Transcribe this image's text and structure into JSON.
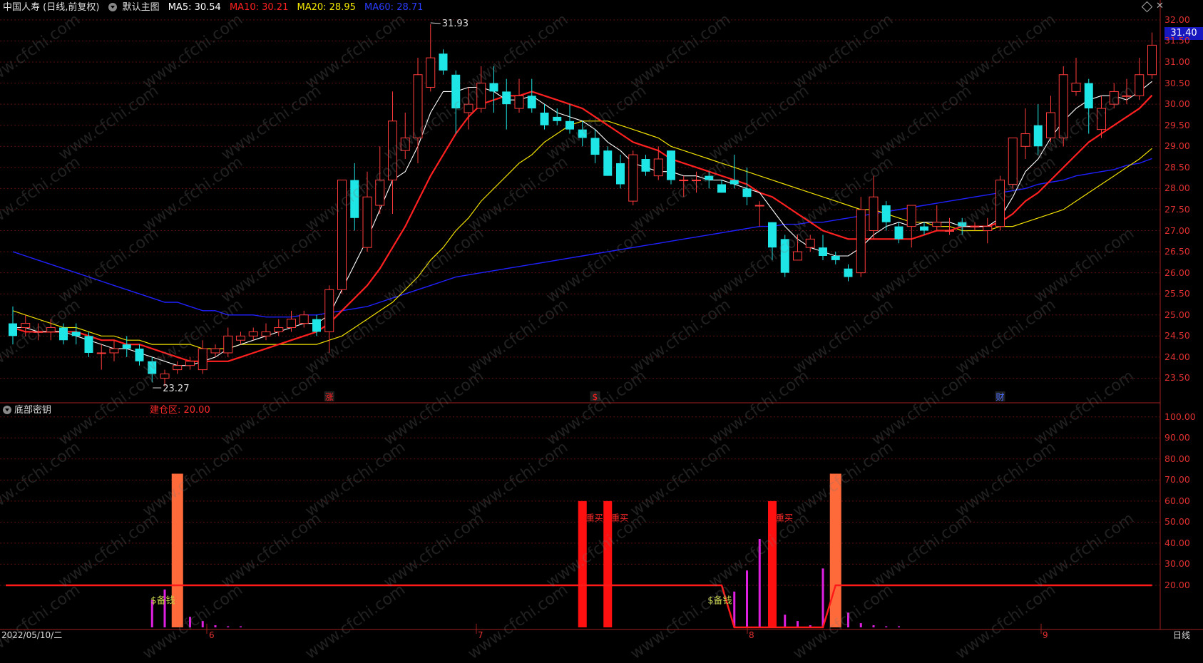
{
  "header": {
    "title": "中国人寿 (日线,前复权)",
    "chart_name": "默认主图",
    "ma5": "MA5: 30.54",
    "ma10": "MA10: 30.21",
    "ma20": "MA20: 28.95",
    "ma60": "MA60: 28.71"
  },
  "sub_header": {
    "name": "底部密钥",
    "value": "建仓区: 20.00"
  },
  "current_price_tag": "31.40",
  "markers": {
    "high": "31.93",
    "low": "23.27",
    "event_up": "涨",
    "event_dollar": "$",
    "event_fin": "财"
  },
  "sub_text": {
    "bei_qian": "$备钱",
    "zhong_mai": "重买"
  },
  "bottom": {
    "date": "2022/05/10/二",
    "months": [
      "6",
      "7",
      "8",
      "9"
    ],
    "period": "日线"
  },
  "watermark": "www.cfchi.com",
  "colors": {
    "bull": "#ff3b3b",
    "bear": "#1fe6e6",
    "ma5": "#ffffff",
    "ma10": "#ff2020",
    "ma20": "#f0e000",
    "ma60": "#2020ff",
    "axis_text": "#e03030"
  },
  "chart_data": [
    {
      "type": "candlestick",
      "title": "中国人寿 (日线,前复权)",
      "ylim": [
        23.0,
        32.1
      ],
      "y_ticks": [
        "32.00",
        "31.50",
        "31.00",
        "30.50",
        "30.00",
        "29.50",
        "29.00",
        "28.50",
        "28.00",
        "27.50",
        "27.00",
        "26.50",
        "26.00",
        "25.50",
        "25.00",
        "24.50",
        "24.00",
        "23.50"
      ],
      "candles": [
        [
          24.8,
          24.5,
          25.2,
          24.3
        ],
        [
          24.7,
          24.8,
          25.0,
          24.5
        ],
        [
          24.6,
          24.6,
          24.8,
          24.4
        ],
        [
          24.6,
          24.7,
          24.9,
          24.4
        ],
        [
          24.7,
          24.4,
          24.8,
          24.3
        ],
        [
          24.6,
          24.5,
          24.8,
          24.3
        ],
        [
          24.5,
          24.1,
          24.6,
          24.0
        ],
        [
          24.1,
          24.1,
          24.3,
          23.7
        ],
        [
          24.1,
          24.2,
          24.4,
          23.9
        ],
        [
          24.3,
          24.2,
          24.5,
          24.0
        ],
        [
          24.2,
          23.9,
          24.3,
          23.8
        ],
        [
          23.9,
          23.6,
          24.0,
          23.4
        ],
        [
          23.5,
          23.6,
          23.7,
          23.3
        ],
        [
          23.7,
          23.8,
          23.9,
          23.6
        ],
        [
          23.8,
          23.9,
          24.0,
          23.7
        ],
        [
          23.7,
          24.2,
          24.4,
          23.6
        ],
        [
          24.1,
          24.2,
          24.3,
          24.0
        ],
        [
          24.1,
          24.5,
          24.7,
          24.0
        ],
        [
          24.4,
          24.5,
          24.6,
          24.3
        ],
        [
          24.5,
          24.6,
          24.7,
          24.4
        ],
        [
          24.5,
          24.6,
          24.8,
          24.4
        ],
        [
          24.6,
          24.7,
          24.9,
          24.5
        ],
        [
          24.7,
          24.9,
          25.1,
          24.6
        ],
        [
          24.8,
          25.0,
          25.1,
          24.7
        ],
        [
          24.9,
          24.6,
          25.0,
          24.5
        ],
        [
          24.6,
          25.6,
          25.7,
          24.1
        ],
        [
          25.6,
          28.2,
          28.2,
          25.5
        ],
        [
          28.2,
          27.3,
          28.6,
          27.0
        ],
        [
          26.6,
          27.8,
          28.4,
          26.5
        ],
        [
          27.6,
          28.2,
          29.0,
          27.4
        ],
        [
          28.2,
          29.6,
          30.3,
          27.4
        ],
        [
          28.9,
          29.2,
          29.8,
          28.7
        ],
        [
          29.2,
          30.7,
          31.1,
          28.6
        ],
        [
          30.4,
          31.1,
          31.9,
          30.3
        ],
        [
          31.2,
          30.8,
          31.3,
          30.7
        ],
        [
          30.7,
          29.9,
          30.8,
          29.3
        ],
        [
          29.8,
          30.0,
          30.4,
          29.4
        ],
        [
          29.9,
          30.5,
          30.9,
          29.8
        ],
        [
          30.5,
          30.3,
          30.9,
          29.8
        ],
        [
          30.3,
          30.0,
          30.6,
          29.4
        ],
        [
          29.9,
          30.2,
          30.6,
          29.8
        ],
        [
          30.2,
          29.9,
          30.6,
          29.8
        ],
        [
          29.8,
          29.5,
          30.0,
          29.4
        ],
        [
          29.7,
          29.6,
          29.9,
          29.5
        ],
        [
          29.6,
          29.4,
          30.0,
          29.3
        ],
        [
          29.4,
          29.2,
          29.6,
          29.0
        ],
        [
          29.2,
          28.8,
          29.4,
          28.6
        ],
        [
          28.9,
          28.3,
          29.0,
          28.3
        ],
        [
          28.6,
          28.1,
          28.8,
          28.0
        ],
        [
          27.7,
          28.8,
          28.9,
          27.6
        ],
        [
          28.7,
          28.4,
          28.8,
          28.3
        ],
        [
          28.3,
          28.7,
          29.0,
          28.2
        ],
        [
          28.9,
          28.2,
          28.9,
          28.1
        ],
        [
          28.2,
          28.2,
          28.3,
          27.8
        ],
        [
          28.2,
          28.2,
          28.4,
          27.9
        ],
        [
          28.3,
          28.2,
          28.4,
          28.0
        ],
        [
          28.1,
          27.9,
          28.2,
          27.9
        ],
        [
          28.2,
          28.1,
          28.8,
          28.0
        ],
        [
          28.0,
          27.8,
          28.5,
          27.6
        ],
        [
          27.6,
          27.6,
          27.7,
          27.1
        ],
        [
          27.2,
          26.6,
          27.2,
          26.3
        ],
        [
          26.8,
          26.0,
          26.9,
          25.9
        ],
        [
          26.3,
          26.5,
          26.9,
          26.3
        ],
        [
          26.6,
          26.8,
          26.9,
          26.5
        ],
        [
          26.6,
          26.4,
          26.9,
          26.3
        ],
        [
          26.4,
          26.3,
          26.5,
          26.2
        ],
        [
          26.1,
          25.9,
          26.2,
          25.8
        ],
        [
          26.0,
          27.5,
          27.8,
          25.9
        ],
        [
          27.0,
          27.8,
          28.3,
          26.8
        ],
        [
          27.6,
          27.2,
          27.7,
          27.0
        ],
        [
          27.1,
          26.8,
          27.2,
          26.7
        ],
        [
          27.1,
          27.6,
          27.6,
          26.6
        ],
        [
          27.1,
          27.0,
          27.2,
          26.9
        ],
        [
          27.1,
          27.2,
          27.6,
          27.0
        ],
        [
          27.0,
          27.0,
          27.3,
          26.9
        ],
        [
          27.2,
          27.1,
          27.3,
          26.9
        ],
        [
          27.1,
          27.1,
          27.2,
          27.0
        ],
        [
          27.0,
          27.1,
          27.3,
          26.7
        ],
        [
          27.1,
          28.2,
          28.3,
          27.0
        ],
        [
          28.1,
          29.2,
          29.2,
          28.0
        ],
        [
          29.0,
          29.3,
          29.9,
          28.7
        ],
        [
          29.5,
          29.0,
          30.0,
          28.8
        ],
        [
          29.2,
          29.8,
          30.2,
          29.1
        ],
        [
          29.2,
          30.7,
          30.9,
          29.0
        ],
        [
          30.3,
          30.5,
          31.1,
          30.2
        ],
        [
          30.5,
          29.9,
          30.6,
          29.3
        ],
        [
          29.4,
          29.9,
          30.2,
          29.2
        ],
        [
          30.0,
          30.3,
          30.5,
          29.9
        ],
        [
          30.2,
          30.2,
          30.6,
          30.0
        ],
        [
          30.2,
          30.7,
          31.1,
          30.1
        ],
        [
          30.7,
          31.4,
          31.7,
          30.6
        ]
      ],
      "ma5": [
        24.7,
        24.7,
        24.6,
        24.6,
        24.6,
        24.5,
        24.4,
        24.3,
        24.2,
        24.2,
        24.1,
        24.0,
        23.9,
        23.8,
        23.8,
        23.9,
        24.0,
        24.2,
        24.3,
        24.4,
        24.5,
        24.6,
        24.7,
        24.8,
        24.8,
        25.0,
        25.6,
        26.2,
        26.8,
        27.5,
        28.2,
        28.4,
        29.0,
        29.8,
        30.3,
        30.3,
        30.4,
        30.4,
        30.3,
        30.1,
        30.1,
        30.2,
        30.0,
        29.8,
        29.7,
        29.6,
        29.4,
        29.1,
        28.9,
        28.6,
        28.5,
        28.4,
        28.4,
        28.3,
        28.3,
        28.2,
        28.2,
        28.1,
        28.0,
        27.9,
        27.5,
        27.1,
        26.8,
        26.6,
        26.5,
        26.4,
        26.4,
        26.6,
        26.9,
        27.1,
        27.2,
        27.1,
        27.2,
        27.2,
        27.2,
        27.1,
        27.1,
        27.1,
        27.3,
        27.8,
        28.4,
        28.7,
        29.2,
        29.6,
        29.9,
        30.1,
        30.2,
        30.2,
        30.1,
        30.3,
        30.54
      ],
      "ma10": [
        24.7,
        24.6,
        24.6,
        24.6,
        24.6,
        24.6,
        24.5,
        24.4,
        24.4,
        24.3,
        24.3,
        24.2,
        24.1,
        24.0,
        23.9,
        23.9,
        23.9,
        23.9,
        24.0,
        24.1,
        24.2,
        24.3,
        24.4,
        24.5,
        24.6,
        24.8,
        25.1,
        25.4,
        25.7,
        26.1,
        26.6,
        27.1,
        27.7,
        28.3,
        28.8,
        29.3,
        29.7,
        30.0,
        30.1,
        30.2,
        30.2,
        30.3,
        30.2,
        30.1,
        30.0,
        29.9,
        29.7,
        29.5,
        29.3,
        29.1,
        29.0,
        28.9,
        28.7,
        28.6,
        28.5,
        28.4,
        28.3,
        28.2,
        28.1,
        27.9,
        27.8,
        27.6,
        27.4,
        27.2,
        27.0,
        26.9,
        26.8,
        26.8,
        26.8,
        26.8,
        26.8,
        26.8,
        26.9,
        27.0,
        27.0,
        27.1,
        27.1,
        27.1,
        27.2,
        27.4,
        27.7,
        27.9,
        28.2,
        28.5,
        28.8,
        29.1,
        29.3,
        29.5,
        29.7,
        29.9,
        30.21
      ],
      "ma20": [
        25.1,
        25.0,
        24.9,
        24.8,
        24.7,
        24.7,
        24.6,
        24.5,
        24.5,
        24.4,
        24.4,
        24.3,
        24.3,
        24.3,
        24.3,
        24.2,
        24.2,
        24.2,
        24.3,
        24.3,
        24.3,
        24.3,
        24.3,
        24.3,
        24.3,
        24.4,
        24.5,
        24.7,
        24.9,
        25.1,
        25.3,
        25.6,
        25.9,
        26.3,
        26.6,
        27.0,
        27.3,
        27.7,
        28.0,
        28.3,
        28.6,
        28.8,
        29.1,
        29.3,
        29.5,
        29.6,
        29.6,
        29.6,
        29.5,
        29.4,
        29.3,
        29.2,
        29.0,
        28.9,
        28.8,
        28.7,
        28.6,
        28.5,
        28.4,
        28.3,
        28.2,
        28.1,
        28.0,
        27.9,
        27.8,
        27.7,
        27.6,
        27.5,
        27.5,
        27.4,
        27.3,
        27.2,
        27.2,
        27.1,
        27.1,
        27.0,
        27.0,
        27.0,
        27.1,
        27.1,
        27.2,
        27.3,
        27.4,
        27.5,
        27.7,
        27.9,
        28.1,
        28.3,
        28.5,
        28.7,
        28.95
      ],
      "ma60": [
        26.5,
        26.4,
        26.3,
        26.2,
        26.1,
        26.0,
        25.9,
        25.8,
        25.7,
        25.6,
        25.5,
        25.4,
        25.3,
        25.3,
        25.2,
        25.1,
        25.1,
        25.0,
        25.0,
        25.0,
        24.95,
        24.95,
        24.95,
        25.0,
        25.0,
        25.05,
        25.1,
        25.15,
        25.2,
        25.3,
        25.4,
        25.5,
        25.6,
        25.7,
        25.8,
        25.9,
        25.95,
        26.0,
        26.05,
        26.1,
        26.15,
        26.2,
        26.25,
        26.3,
        26.35,
        26.4,
        26.45,
        26.5,
        26.55,
        26.6,
        26.65,
        26.7,
        26.75,
        26.8,
        26.85,
        26.9,
        26.95,
        27.0,
        27.05,
        27.1,
        27.1,
        27.15,
        27.15,
        27.2,
        27.2,
        27.25,
        27.3,
        27.35,
        27.4,
        27.45,
        27.5,
        27.55,
        27.6,
        27.65,
        27.7,
        27.75,
        27.8,
        27.85,
        27.9,
        27.95,
        28.0,
        28.1,
        28.15,
        28.2,
        28.3,
        28.35,
        28.4,
        28.45,
        28.55,
        28.6,
        28.71
      ]
    },
    {
      "type": "bar",
      "title": "底部密钥",
      "ylim": [
        0,
        105
      ],
      "y_ticks": [
        "100.00",
        "90.00",
        "80.00",
        "70.00",
        "60.00",
        "50.00",
        "40.00",
        "30.00",
        "20.00"
      ],
      "baseline_value": 20.0,
      "orange_bars": [
        {
          "index": 13,
          "value": 73
        },
        {
          "index": 65,
          "value": 73
        }
      ],
      "red_bars": [
        {
          "index": 45,
          "value": 60
        },
        {
          "index": 47,
          "value": 60
        },
        {
          "index": 60,
          "value": 60
        }
      ],
      "magenta_bars": [
        {
          "index": 11,
          "value": 13
        },
        {
          "index": 12,
          "value": 18
        },
        {
          "index": 14,
          "value": 5
        },
        {
          "index": 15,
          "value": 3
        },
        {
          "index": 16,
          "value": 1
        },
        {
          "index": 17,
          "value": 0.5
        },
        {
          "index": 18,
          "value": 0.5
        },
        {
          "index": 57,
          "value": 17
        },
        {
          "index": 58,
          "value": 27
        },
        {
          "index": 59,
          "value": 42
        },
        {
          "index": 60,
          "value": 52
        },
        {
          "index": 61,
          "value": 6
        },
        {
          "index": 62,
          "value": 3
        },
        {
          "index": 63,
          "value": 1
        },
        {
          "index": 64,
          "value": 28
        },
        {
          "index": 66,
          "value": 7
        },
        {
          "index": 67,
          "value": 2
        },
        {
          "index": 68,
          "value": 1
        },
        {
          "index": 69,
          "value": 0.5
        },
        {
          "index": 70,
          "value": 0.5
        }
      ],
      "line_drop": {
        "start": 56,
        "bottom_from": 57,
        "bottom_to": 64,
        "end": 65
      }
    }
  ]
}
